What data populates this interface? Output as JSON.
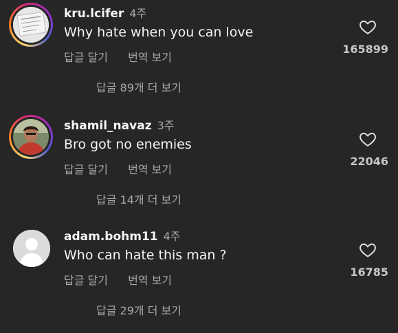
{
  "comments": [
    {
      "username": "kru.lcifer",
      "time": "4주",
      "text": "Why hate when you can love",
      "reply_label": "답글 달기",
      "translate_label": "번역 보기",
      "view_replies": "답글 89개 더 보기",
      "likes": "165899"
    },
    {
      "username": "shamil_navaz",
      "time": "3주",
      "text": "Bro got no enemies",
      "reply_label": "답글 달기",
      "translate_label": "번역 보기",
      "view_replies": "답글 14개 더 보기",
      "likes": "22046"
    },
    {
      "username": "adam.bohm11",
      "time": "4주",
      "text": "Who can hate this man ?",
      "reply_label": "답글 달기",
      "translate_label": "번역 보기",
      "view_replies": "답글 29개 더 보기",
      "likes": "16785"
    }
  ],
  "icons": {
    "like": "heart-outline-icon"
  },
  "colors": {
    "background": "#262626",
    "primary_text": "#f5f5f5",
    "secondary_text": "#a8a8a8"
  }
}
